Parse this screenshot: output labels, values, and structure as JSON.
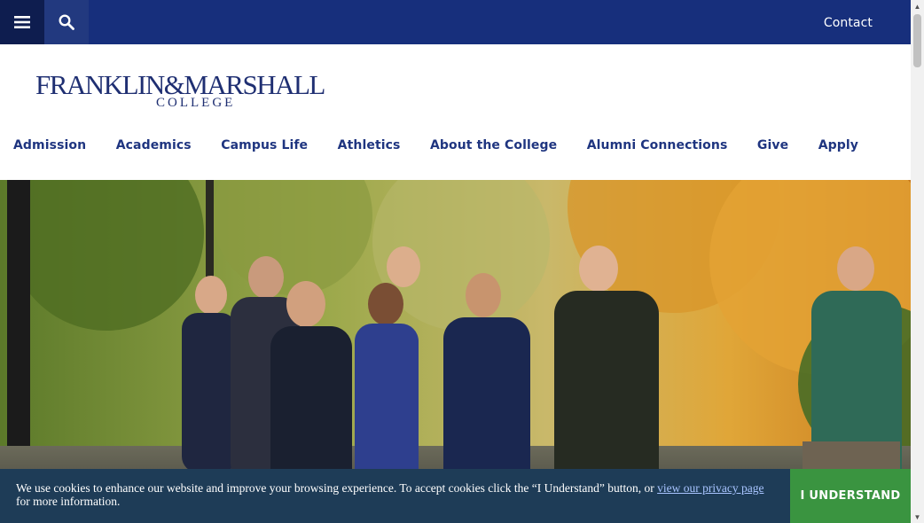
{
  "topbar": {
    "menu_icon": "hamburger-menu-icon",
    "search_icon": "search-icon",
    "contact_label": "Contact",
    "bg_color": "#172f7c"
  },
  "logo": {
    "line1": "FRANKLIN&MARSHALL",
    "line2": "COLLEGE"
  },
  "nav": {
    "items": [
      {
        "label": "Admission"
      },
      {
        "label": "Academics"
      },
      {
        "label": "Campus Life"
      },
      {
        "label": "Athletics"
      },
      {
        "label": "About the College"
      },
      {
        "label": "Alumni Connections"
      },
      {
        "label": "Give"
      },
      {
        "label": "Apply"
      }
    ],
    "color": "#1f3580"
  },
  "hero": {
    "image_icon": "students-walking-on-campus-photo"
  },
  "cookie_banner": {
    "text_before": "We use cookies to enhance our website and improve your browsing experience. To accept cookies click the “I Understand” button, or ",
    "link_text": "view our privacy page",
    "text_after": " for more information.",
    "button_label": "I UNDERSTAND",
    "bg_color": "#1e3c57",
    "button_color": "#3a9440"
  },
  "scrollbar": {
    "up_icon": "scroll-up-arrow-icon",
    "down_icon": "scroll-down-arrow-icon"
  }
}
